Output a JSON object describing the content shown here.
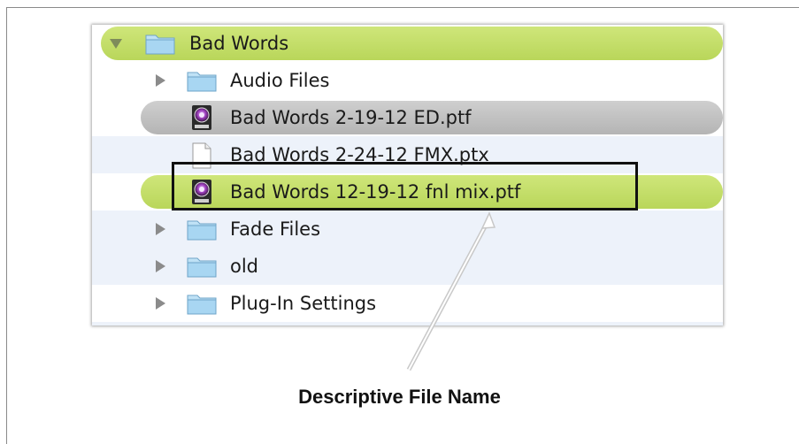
{
  "tree": {
    "root": {
      "name": "Bad Words",
      "expanded": true
    },
    "items": [
      {
        "name": "Audio Files",
        "type": "folder"
      },
      {
        "name": "Bad Words 2-19-12 ED.ptf",
        "type": "protools-session",
        "state": "selected-grey"
      },
      {
        "name": "Bad Words 2-24-12 FMX.ptx",
        "type": "document"
      },
      {
        "name": "Bad Words 12-19-12 fnl mix.ptf",
        "type": "protools-session",
        "state": "selected-green"
      },
      {
        "name": "Fade Files",
        "type": "folder"
      },
      {
        "name": "old",
        "type": "folder"
      },
      {
        "name": "Plug-In Settings",
        "type": "folder"
      }
    ]
  },
  "annotation": {
    "caption": "Descriptive File Name"
  },
  "colors": {
    "selection_green": "#bfd962",
    "selection_grey": "#bdbdbd",
    "alt_row": "#edf2fa",
    "folder_blue": "#9fd0ee"
  }
}
